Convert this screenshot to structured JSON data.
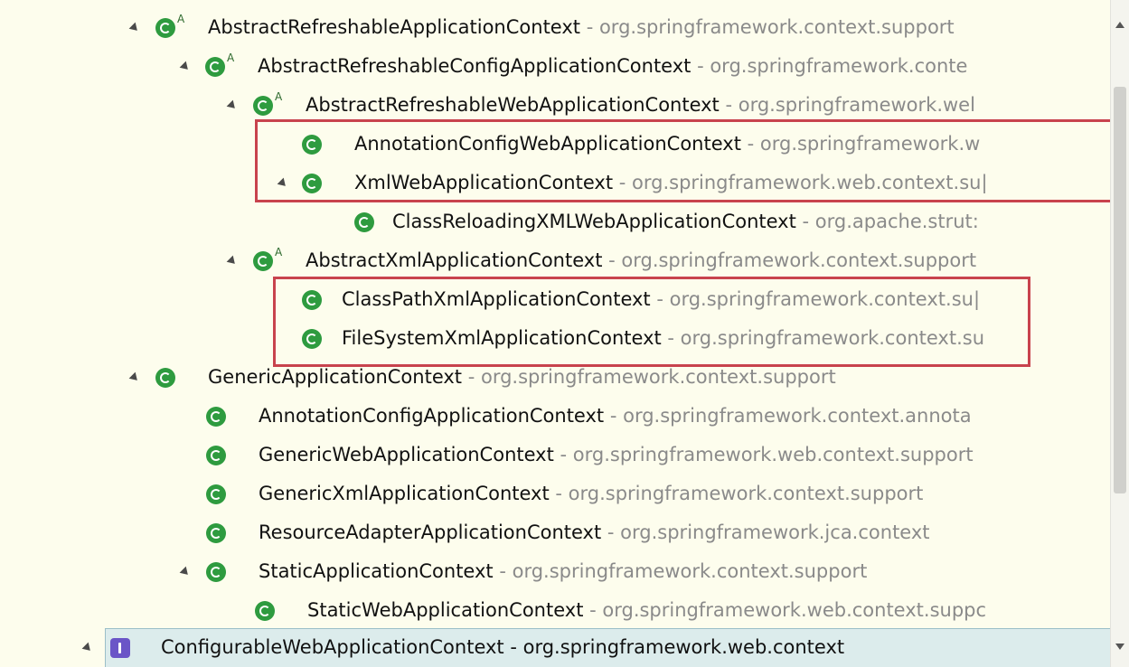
{
  "tree": {
    "rows": [
      {
        "name": "AbstractRefreshableApplicationContext",
        "package": "org.springframework.context.support",
        "abstract_marker": "A",
        "icon": "class-icon",
        "expanded": true
      },
      {
        "name": "AbstractRefreshableConfigApplicationContext",
        "package": "org.springframework.conte",
        "abstract_marker": "A",
        "icon": "class-icon",
        "expanded": true
      },
      {
        "name": "AbstractRefreshableWebApplicationContext",
        "package": "org.springframework.wel",
        "abstract_marker": "A",
        "icon": "class-icon",
        "expanded": true
      },
      {
        "name": "AnnotationConfigWebApplicationContext",
        "package": "org.springframework.w",
        "icon": "class-icon"
      },
      {
        "name": "XmlWebApplicationContext",
        "package": "org.springframework.web.context.su|",
        "icon": "class-icon",
        "expanded": true
      },
      {
        "name": "ClassReloadingXMLWebApplicationContext",
        "package": "org.apache.strut:",
        "icon": "class-icon"
      },
      {
        "name": "AbstractXmlApplicationContext",
        "package": "org.springframework.context.support",
        "abstract_marker": "A",
        "icon": "class-icon",
        "expanded": true
      },
      {
        "name": "ClassPathXmlApplicationContext",
        "package": "org.springframework.context.su|",
        "icon": "class-icon"
      },
      {
        "name": "FileSystemXmlApplicationContext",
        "package": "org.springframework.context.su",
        "icon": "class-icon"
      },
      {
        "name": "GenericApplicationContext",
        "package": "org.springframework.context.support",
        "icon": "class-icon",
        "expanded": true
      },
      {
        "name": "AnnotationConfigApplicationContext",
        "package": "org.springframework.context.annota",
        "icon": "class-icon"
      },
      {
        "name": "GenericWebApplicationContext",
        "package": "org.springframework.web.context.support",
        "icon": "class-icon"
      },
      {
        "name": "GenericXmlApplicationContext",
        "package": "org.springframework.context.support",
        "icon": "class-icon"
      },
      {
        "name": "ResourceAdapterApplicationContext",
        "package": "org.springframework.jca.context",
        "icon": "class-icon"
      },
      {
        "name": "StaticApplicationContext",
        "package": "org.springframework.context.support",
        "icon": "class-icon",
        "expanded": true
      },
      {
        "name": "StaticWebApplicationContext",
        "package": "org.springframework.web.context.suppc",
        "icon": "class-icon"
      },
      {
        "name": "ConfigurableWebApplicationContext",
        "package": "org.springframework.web.context",
        "icon": "interface-icon",
        "expanded": true,
        "selected": true
      }
    ],
    "separator": " - "
  },
  "colors": {
    "background": "#fdfded",
    "class_icon": "#2e9b3f",
    "interface_icon": "#6b55c7",
    "highlight_box": "#c8434d",
    "package_text": "#8a8a8a"
  }
}
